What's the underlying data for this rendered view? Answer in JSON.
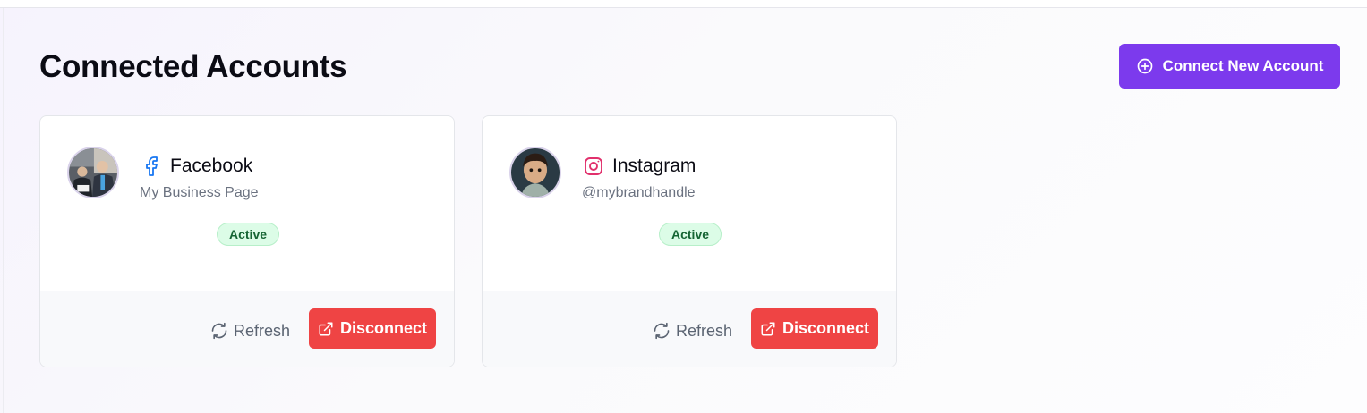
{
  "page": {
    "title": "Connected Accounts"
  },
  "header": {
    "connect_button_label": "Connect New Account",
    "connect_button_icon": "plus-circle-icon",
    "accent_color": "#7c3aed"
  },
  "accounts": [
    {
      "platform": "Facebook",
      "platform_icon": "facebook-icon",
      "platform_color": "#1877f2",
      "handle": "My Business Page",
      "status": "Active",
      "refresh_label": "Refresh",
      "disconnect_label": "Disconnect"
    },
    {
      "platform": "Instagram",
      "platform_icon": "instagram-icon",
      "platform_color": "#e1306c",
      "handle": "@mybrandhandle",
      "status": "Active",
      "refresh_label": "Refresh",
      "disconnect_label": "Disconnect"
    }
  ],
  "colors": {
    "status_active_bg": "#dcfce7",
    "status_active_text": "#166534",
    "danger": "#ef4444"
  }
}
